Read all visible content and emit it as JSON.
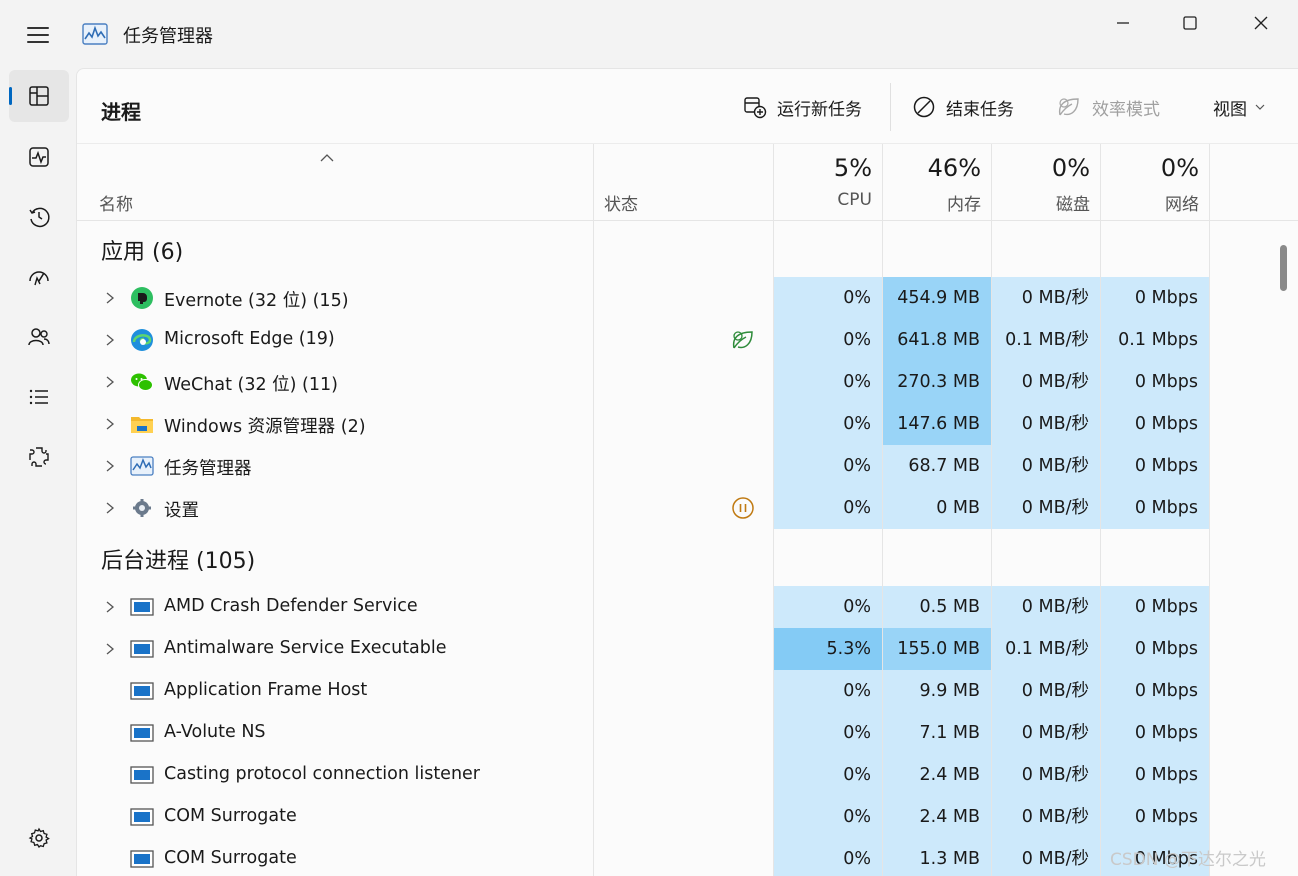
{
  "window": {
    "title": "任务管理器",
    "icon": "task-manager-icon"
  },
  "nav": {
    "items": [
      {
        "name": "processes",
        "icon": "processes-icon",
        "active": true
      },
      {
        "name": "performance",
        "icon": "performance-icon"
      },
      {
        "name": "app-history",
        "icon": "history-icon"
      },
      {
        "name": "startup",
        "icon": "startup-icon"
      },
      {
        "name": "users",
        "icon": "users-icon"
      },
      {
        "name": "details",
        "icon": "details-icon"
      },
      {
        "name": "services",
        "icon": "services-icon"
      }
    ],
    "settings_icon": "settings-icon"
  },
  "header": {
    "page_title": "进程",
    "run_task": "运行新任务",
    "end_task": "结束任务",
    "efficiency_mode": "效率模式",
    "view": "视图"
  },
  "columns": {
    "name": "名称",
    "status": "状态",
    "cpu_pct": "5%",
    "cpu": "CPU",
    "mem_pct": "46%",
    "mem": "内存",
    "disk_pct": "0%",
    "disk": "磁盘",
    "net_pct": "0%",
    "net": "网络"
  },
  "groups": {
    "apps": {
      "title": "应用 (6)",
      "rows": [
        {
          "name": "Evernote (32 位) (15)",
          "cpu": "0%",
          "mem": "454.9 MB",
          "disk": "0 MB/秒",
          "net": "0 Mbps"
        },
        {
          "name": "Microsoft Edge (19)",
          "cpu": "0%",
          "mem": "641.8 MB",
          "disk": "0.1 MB/秒",
          "net": "0.1 Mbps"
        },
        {
          "name": "WeChat (32 位) (11)",
          "cpu": "0%",
          "mem": "270.3 MB",
          "disk": "0 MB/秒",
          "net": "0 Mbps"
        },
        {
          "name": "Windows 资源管理器 (2)",
          "cpu": "0%",
          "mem": "147.6 MB",
          "disk": "0 MB/秒",
          "net": "0 Mbps"
        },
        {
          "name": "任务管理器",
          "cpu": "0%",
          "mem": "68.7 MB",
          "disk": "0 MB/秒",
          "net": "0 Mbps"
        },
        {
          "name": "设置",
          "cpu": "0%",
          "mem": "0 MB",
          "disk": "0 MB/秒",
          "net": "0 Mbps"
        }
      ]
    },
    "background": {
      "title": "后台进程 (105)",
      "rows": [
        {
          "name": "AMD Crash Defender Service",
          "cpu": "0%",
          "mem": "0.5 MB",
          "disk": "0 MB/秒",
          "net": "0 Mbps"
        },
        {
          "name": "Antimalware Service Executable",
          "cpu": "5.3%",
          "mem": "155.0 MB",
          "disk": "0.1 MB/秒",
          "net": "0 Mbps"
        },
        {
          "name": "Application Frame Host",
          "cpu": "0%",
          "mem": "9.9 MB",
          "disk": "0 MB/秒",
          "net": "0 Mbps"
        },
        {
          "name": "A-Volute NS",
          "cpu": "0%",
          "mem": "7.1 MB",
          "disk": "0 MB/秒",
          "net": "0 Mbps"
        },
        {
          "name": "Casting protocol connection listener",
          "cpu": "0%",
          "mem": "2.4 MB",
          "disk": "0 MB/秒",
          "net": "0 Mbps"
        },
        {
          "name": "COM Surrogate",
          "cpu": "0%",
          "mem": "2.4 MB",
          "disk": "0 MB/秒",
          "net": "0 Mbps"
        },
        {
          "name": "COM Surrogate",
          "cpu": "0%",
          "mem": "1.3 MB",
          "disk": "0 MB/秒",
          "net": "0 Mbps"
        }
      ]
    }
  },
  "watermark": "CSDN @下达尔之光",
  "colors": {
    "accent": "#0067c0",
    "heat_low": "#cde9fb",
    "heat_mid": "#99d4f7",
    "heat_high": "#84cbf5"
  }
}
